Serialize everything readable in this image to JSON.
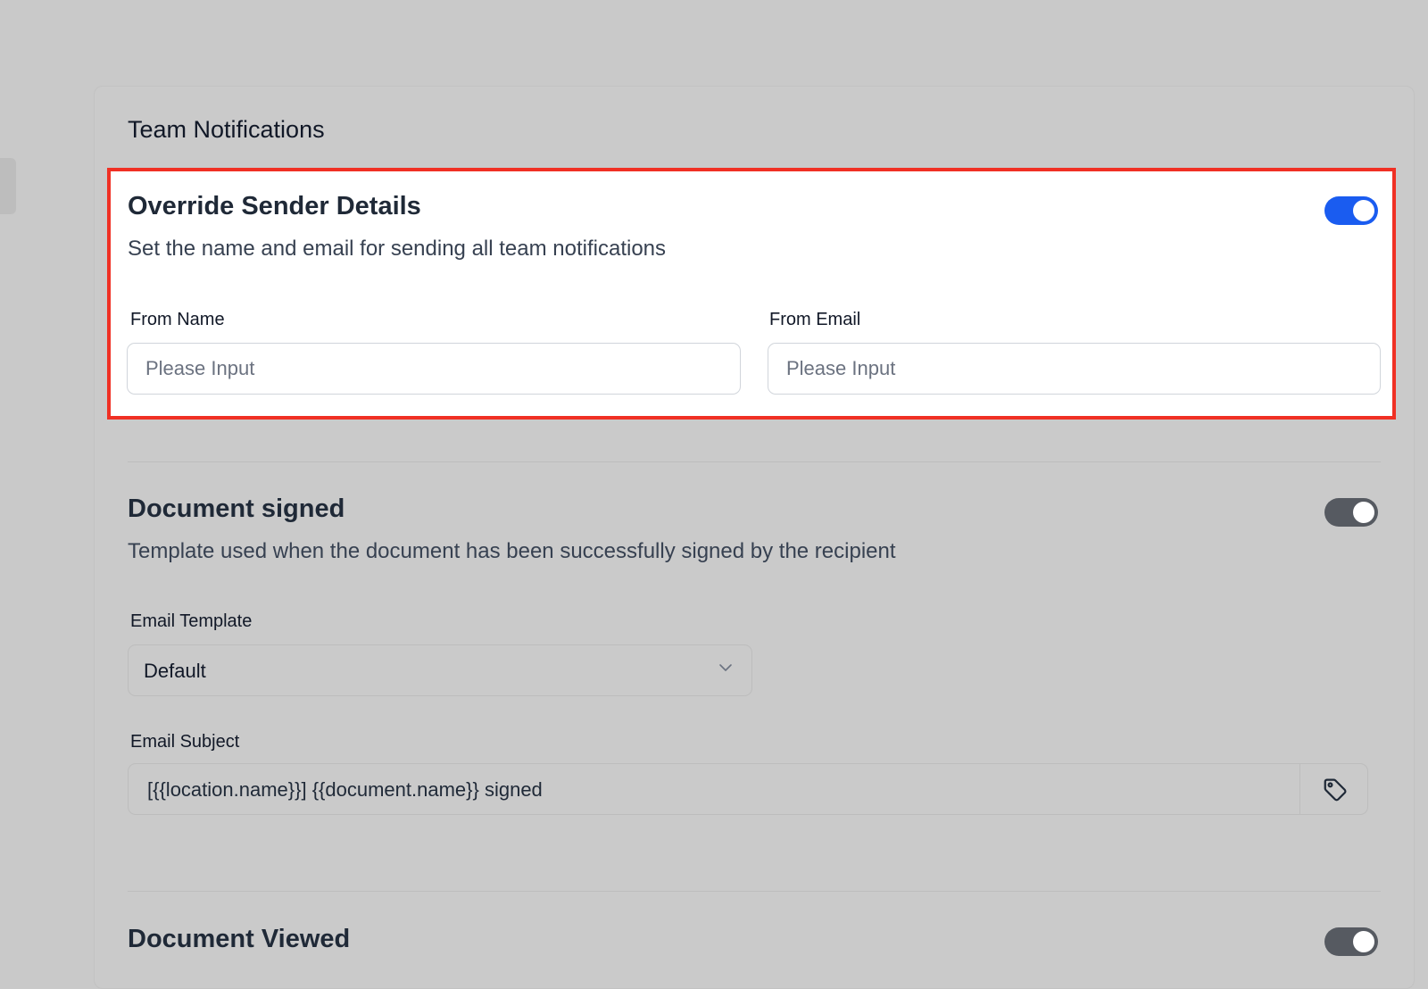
{
  "card": {
    "title": "Team Notifications"
  },
  "override_sender": {
    "title": "Override Sender Details",
    "description": "Set the name and email for sending all team notifications",
    "enabled": true,
    "from_name_label": "From Name",
    "from_name_placeholder": "Please Input",
    "from_name_value": "",
    "from_email_label": "From Email",
    "from_email_placeholder": "Please Input",
    "from_email_value": ""
  },
  "document_signed": {
    "title": "Document signed",
    "description": "Template used when the document has been successfully signed by the recipient",
    "enabled": true,
    "email_template_label": "Email Template",
    "email_template_value": "Default",
    "email_subject_label": "Email Subject",
    "email_subject_value": "[{{location.name}}] {{document.name}} signed"
  },
  "document_viewed": {
    "title": "Document Viewed",
    "enabled": true
  },
  "colors": {
    "highlight_border": "#f03024",
    "toggle_active": "#1a5cf0",
    "toggle_dimmed": "#565a61"
  },
  "icons": {
    "select_chevron": "chevron-down-icon",
    "subject_tag": "tag-icon"
  }
}
